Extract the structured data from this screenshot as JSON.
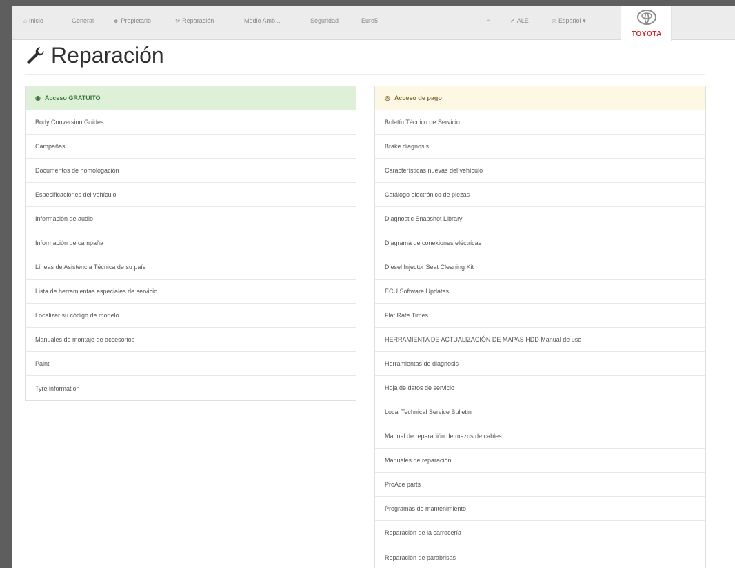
{
  "nav": {
    "items": [
      {
        "label": "Inicio",
        "icon": "home-icon",
        "glyph": "⌂"
      },
      {
        "label": "General",
        "icon": "",
        "glyph": ""
      },
      {
        "label": "Propietario",
        "icon": "user-icon",
        "glyph": "☻"
      },
      {
        "label": "Reparación",
        "icon": "wrench-icon",
        "glyph": "⚒"
      },
      {
        "label": "Medio Amb...",
        "icon": "",
        "glyph": ""
      },
      {
        "label": "Seguridad",
        "icon": "",
        "glyph": ""
      },
      {
        "label": "Euro5",
        "icon": "",
        "glyph": ""
      }
    ],
    "cart_glyph": "≡",
    "user_label": "ALE",
    "user_glyph": "✔",
    "language_label": "Español ▾",
    "language_glyph": "◎"
  },
  "brand": {
    "name": "TOYOTA",
    "color": "#d4242a"
  },
  "page": {
    "title": "Reparación"
  },
  "free_panel": {
    "heading": "Acceso GRATUITO",
    "icon": "eye-icon",
    "glyph": "◉",
    "color": "#3c763d",
    "items": [
      "Body Conversion Guides",
      "Campañas",
      "Documentos de homologación",
      "Especificaciones del vehículo",
      "Información de audio",
      "Información de campaña",
      "Líneas de Asistencia Técnica de su país",
      "Lista de herramientas especiales de servicio",
      "Localizar su código de modelo",
      "Manuales de montaje de accesorios",
      "Paint",
      "Tyre information"
    ]
  },
  "paid_panel": {
    "heading": "Acceso de pago",
    "icon": "paid-eye-icon",
    "glyph": "◎",
    "color": "#8a6d3b",
    "items": [
      "Boletín Técnico de Servicio",
      "Brake diagnosis",
      "Características nuevas del vehículo",
      "Catálogo electrónico de piezas",
      "Diagnostic Snapshot Library",
      "Diagrama de conexiones eléctricas",
      "Diesel Injector Seat Cleaning Kit",
      "ECU Software Updates",
      "Flat Rate Times",
      "HERRAMIENTA DE ACTUALIZACIÓN DE MAPAS HDD Manual de uso",
      "Herramientas de diagnosis",
      "Hoja de datos de servicio",
      "Local Technical Service Bulletin",
      "Manual de reparación de mazos de cables",
      "Manuales de reparación",
      "ProAce parts",
      "Programas de mantenimiento",
      "Reparación de la carrocería",
      "Reparación de parabrisas"
    ]
  }
}
